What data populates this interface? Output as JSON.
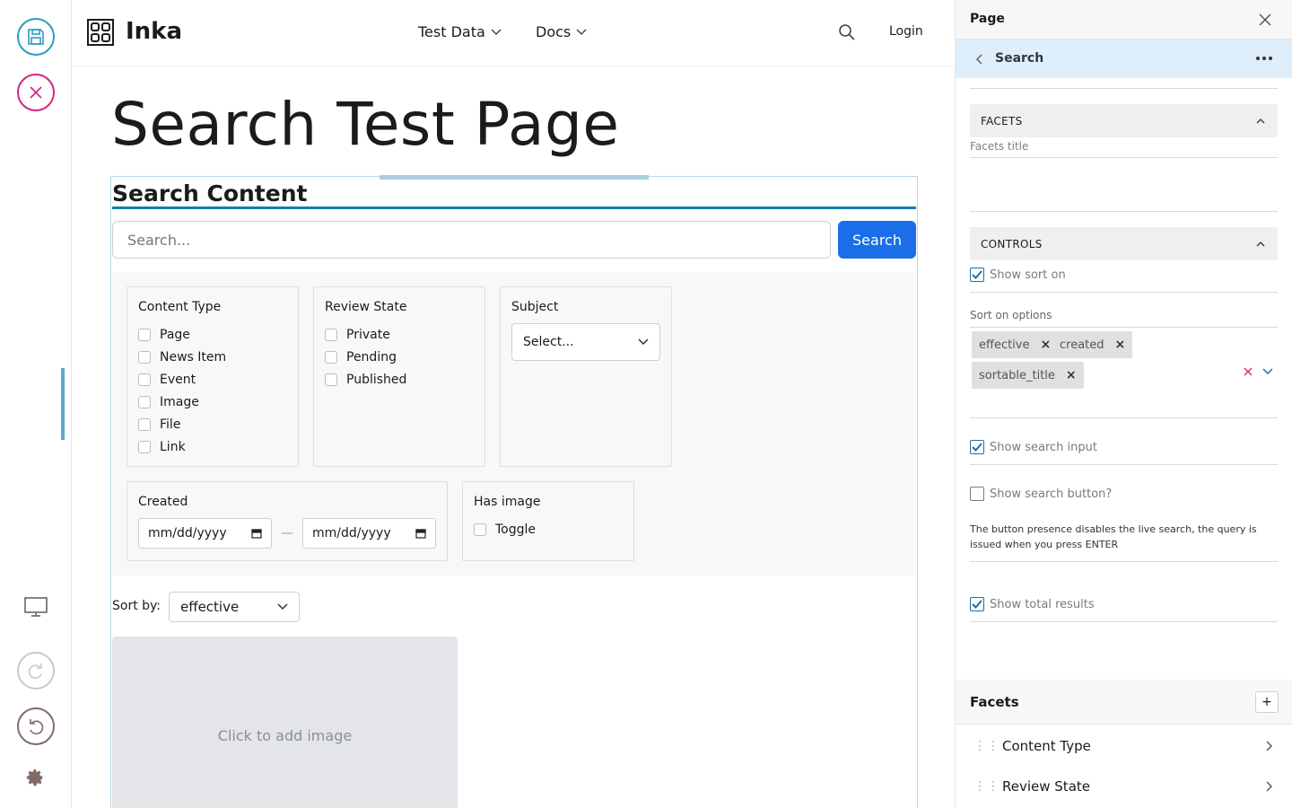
{
  "toolbar": {
    "save_icon": "save-icon",
    "cancel_icon": "close-icon",
    "display_icon": "monitor-icon",
    "redo_icon": "redo-icon",
    "undo_icon": "undo-icon",
    "settings_icon": "gear-icon"
  },
  "header": {
    "site_name": "Inka",
    "nav": [
      {
        "label": "Test Data"
      },
      {
        "label": "Docs"
      }
    ],
    "login_label": "Login"
  },
  "page": {
    "title": "Search Test Page"
  },
  "search_block": {
    "heading": "Search Content",
    "placeholder": "Search...",
    "button_label": "Search",
    "facets": {
      "content_type": {
        "title": "Content Type",
        "options": [
          "Page",
          "News Item",
          "Event",
          "Image",
          "File",
          "Link"
        ]
      },
      "review_state": {
        "title": "Review State",
        "options": [
          "Private",
          "Pending",
          "Published"
        ]
      },
      "subject": {
        "title": "Subject",
        "select_value": "Select..."
      },
      "created": {
        "title": "Created",
        "start_placeholder": "mm/dd/yyyy",
        "separator": "—",
        "end_placeholder": "mm/dd/yyyy"
      },
      "has_image": {
        "title": "Has image",
        "option": "Toggle"
      }
    },
    "sort_label": "Sort by:",
    "sort_value": "effective",
    "image_placeholder": "Click to add image"
  },
  "sidebar": {
    "title": "Page",
    "breadcrumb": "Search",
    "facets_section": "FACETS",
    "facets_title_label": "Facets title",
    "controls_section": "CONTROLS",
    "show_sort_on": "Show sort on",
    "sort_on_options_label": "Sort on options",
    "sort_tags": [
      "effective",
      "created",
      "sortable_title"
    ],
    "show_search_input": "Show search input",
    "show_search_button": "Show search button?",
    "search_button_note": "The button presence disables the live search, the query is issued when you press ENTER",
    "show_total_results": "Show total results",
    "facets_list_title": "Facets",
    "add_label": "+",
    "facet_items": [
      "Content Type",
      "Review State"
    ],
    "colors": {
      "accent": "#1a6ee8",
      "crumb_bg": "#deeefa",
      "checkbox": "#1b6fa8"
    }
  }
}
